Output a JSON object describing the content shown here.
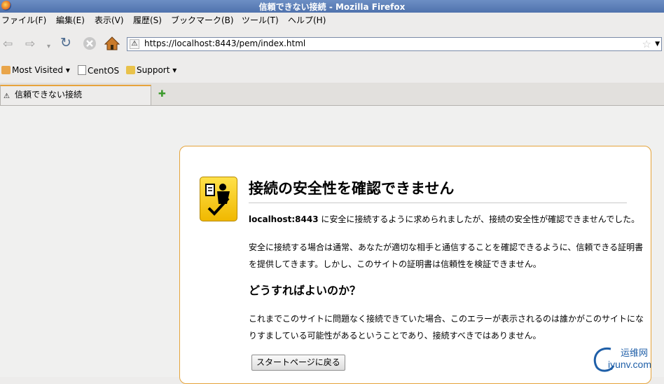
{
  "window": {
    "title": "信頼できない接続 - Mozilla Firefox"
  },
  "menu": [
    "ファイル(F)",
    "編集(E)",
    "表示(V)",
    "履歴(S)",
    "ブックマーク(B)",
    "ツール(T)",
    "ヘルプ(H)"
  ],
  "nav": {
    "url": "https://localhost:8443/pem/index.html"
  },
  "bookmarks": [
    "Most Visited",
    "CentOS",
    "Support"
  ],
  "tabs": [
    {
      "label": "信頼できない接続"
    }
  ],
  "page": {
    "title": "接続の安全性を確認できません",
    "host": "localhost:8443",
    "intro_rest": " に安全に接続するように求められましたが、接続の安全性が確認できませんでした。",
    "para2_line1": "安全に接続する場合は通常、あなたが適切な相手と通信することを確認できるように、信頼できる証明書",
    "para2_line2": "を提供してきます。しかし、このサイトの証明書は信頼性を検証できません。",
    "heading2": "どうすればよいのか？",
    "para3_line1": "これまでこのサイトに問題なく接続できていた場合、このエラーが表示されるのは誰かがこのサイトにな",
    "para3_line2": "りすましている可能性があるということであり、接続すべきではありません。",
    "button": "スタートページに戻る"
  },
  "watermark": {
    "cn": "运维网",
    "en": "iyunv.com"
  },
  "icons": [
    "back-icon",
    "forward-icon",
    "reload-icon",
    "stop-icon",
    "home-icon",
    "warning-icon",
    "star-icon",
    "new-tab-icon",
    "identity-icon"
  ],
  "colors": {
    "accent": "#e5a33a",
    "titlebar": "#4f72ad"
  }
}
